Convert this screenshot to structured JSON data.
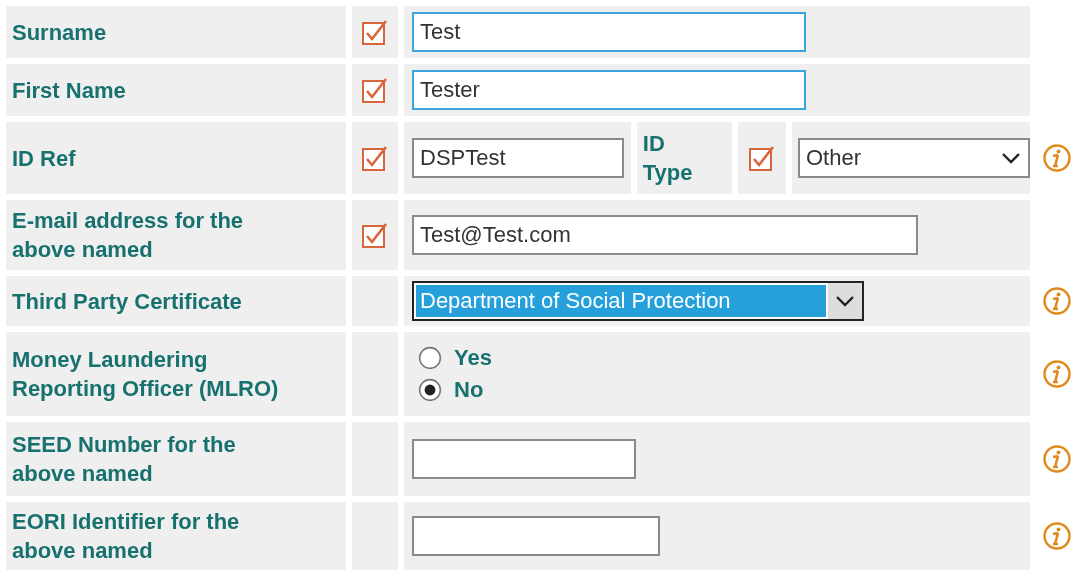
{
  "rows": [
    {
      "kind": "input",
      "label": "Surname",
      "checkbox": {
        "checked": true
      },
      "field": {
        "value": "Test",
        "focused": true
      },
      "info": false
    },
    {
      "kind": "input",
      "label": "First Name",
      "checkbox": {
        "checked": true
      },
      "field": {
        "value": "Tester",
        "focused": true
      },
      "info": false
    },
    {
      "kind": "split",
      "label": "ID Ref",
      "checkbox": {
        "checked": true
      },
      "field": {
        "value": "DSPTest",
        "focused": false
      },
      "sub_label": "ID Type",
      "sub_checkbox": {
        "checked": true
      },
      "select": {
        "value": "Other",
        "focused": false
      },
      "info": true
    },
    {
      "kind": "input",
      "label": "E-mail address for the above named",
      "checkbox": {
        "checked": true
      },
      "field": {
        "value": "Test@Test.com",
        "focused": false
      },
      "info": false
    },
    {
      "kind": "select",
      "label": "Third Party Certificate",
      "select": {
        "value": "Department of Social Protection",
        "focused": true
      },
      "info": true
    },
    {
      "kind": "radio",
      "label": "Money Laundering Reporting Officer (MLRO)",
      "options": [
        {
          "label": "Yes",
          "selected": false
        },
        {
          "label": "No",
          "selected": true
        }
      ],
      "info": true
    },
    {
      "kind": "input",
      "label": "SEED Number for the above named",
      "field": {
        "focused": false
      },
      "info": true
    },
    {
      "kind": "input",
      "label": "EORI Identifier for the above named",
      "field": {
        "focused": false
      },
      "info": true
    }
  ]
}
